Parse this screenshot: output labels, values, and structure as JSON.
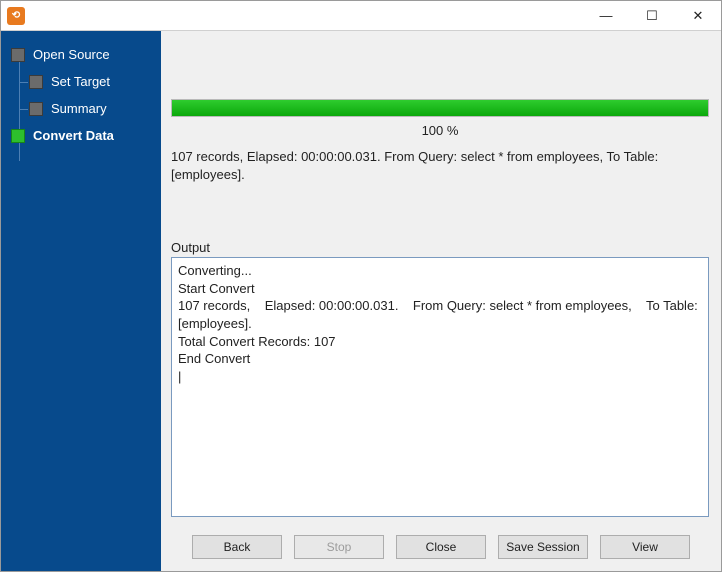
{
  "app": {
    "icon_glyph": "⟲"
  },
  "win": {
    "min": "—",
    "max": "☐",
    "close": "✕"
  },
  "sidebar": {
    "items": [
      {
        "label": "Open Source",
        "level": "top",
        "active": false
      },
      {
        "label": "Set Target",
        "level": "child",
        "active": false
      },
      {
        "label": "Summary",
        "level": "child",
        "active": false
      },
      {
        "label": "Convert Data",
        "level": "top",
        "active": true
      }
    ]
  },
  "progress": {
    "percent": 100,
    "percent_label": "100 %"
  },
  "status": {
    "line": "107 records,    Elapsed: 00:00:00.031.    From Query: select * from employees,    To Table: [employees]."
  },
  "output": {
    "label": "Output",
    "text": "Converting...\nStart Convert\n107 records,    Elapsed: 00:00:00.031.    From Query: select * from employees,    To Table:\n[employees].\nTotal Convert Records: 107\nEnd Convert\n|"
  },
  "buttons": {
    "back": "Back",
    "stop": "Stop",
    "close": "Close",
    "save_session": "Save Session",
    "view": "View"
  }
}
